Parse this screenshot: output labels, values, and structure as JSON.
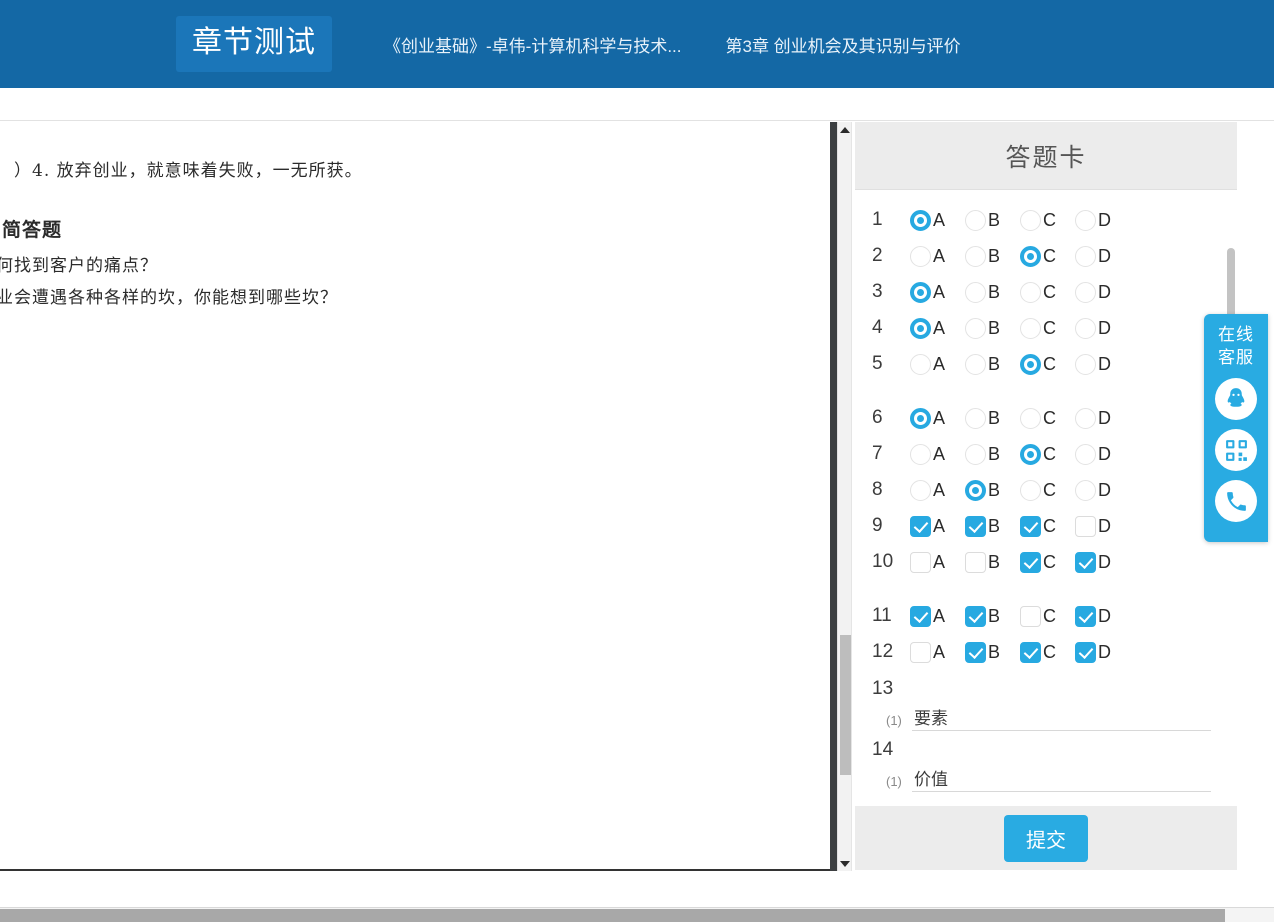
{
  "header": {
    "badge": "章节测试",
    "course": "《创业基础》-卓伟-计算机科学与技术...",
    "chapter": "第3章 创业机会及其识别与评价",
    "bg_color": "#1468a5",
    "badge_bg": "#1b76b9"
  },
  "document": {
    "question4": "）4.  放弃创业，就意味着失败，一无所获。",
    "section_heading": "、简答题",
    "sub1": "如何找到客户的痛点？",
    "sub2": "创业会遭遇各种各样的坎，你能想到哪些坎？"
  },
  "answer_card": {
    "title": "答题卡",
    "option_labels": [
      "A",
      "B",
      "C",
      "D"
    ],
    "rows": [
      {
        "num": "1",
        "type": "radio",
        "selected": [
          0
        ],
        "gap": false
      },
      {
        "num": "2",
        "type": "radio",
        "selected": [
          2
        ],
        "gap": false
      },
      {
        "num": "3",
        "type": "radio",
        "selected": [
          0
        ],
        "gap": false
      },
      {
        "num": "4",
        "type": "radio",
        "selected": [
          0
        ],
        "gap": false
      },
      {
        "num": "5",
        "type": "radio",
        "selected": [
          2
        ],
        "gap": false
      },
      {
        "num": "6",
        "type": "radio",
        "selected": [
          0
        ],
        "gap": true
      },
      {
        "num": "7",
        "type": "radio",
        "selected": [
          2
        ],
        "gap": false
      },
      {
        "num": "8",
        "type": "radio",
        "selected": [
          1
        ],
        "gap": false
      },
      {
        "num": "9",
        "type": "checkbox",
        "selected": [
          0,
          1,
          2
        ],
        "gap": false
      },
      {
        "num": "10",
        "type": "checkbox",
        "selected": [
          2,
          3
        ],
        "gap": false
      },
      {
        "num": "11",
        "type": "checkbox",
        "selected": [
          0,
          1,
          3
        ],
        "gap": true
      },
      {
        "num": "12",
        "type": "checkbox",
        "selected": [
          1,
          2,
          3
        ],
        "gap": false
      }
    ],
    "fill_groups": [
      {
        "num": "13",
        "blanks": [
          {
            "label": "(1)",
            "value": "要素"
          }
        ]
      },
      {
        "num": "14",
        "blanks": [
          {
            "label": "(1)",
            "value": "价值"
          }
        ]
      }
    ],
    "submit_label": "提交",
    "accent_color": "#29abe2"
  },
  "service_widget": {
    "line1": "在线",
    "line2": "客服",
    "icons": [
      "qq-icon",
      "qrcode-icon",
      "phone-icon"
    ],
    "bg_color": "#29abe2"
  }
}
